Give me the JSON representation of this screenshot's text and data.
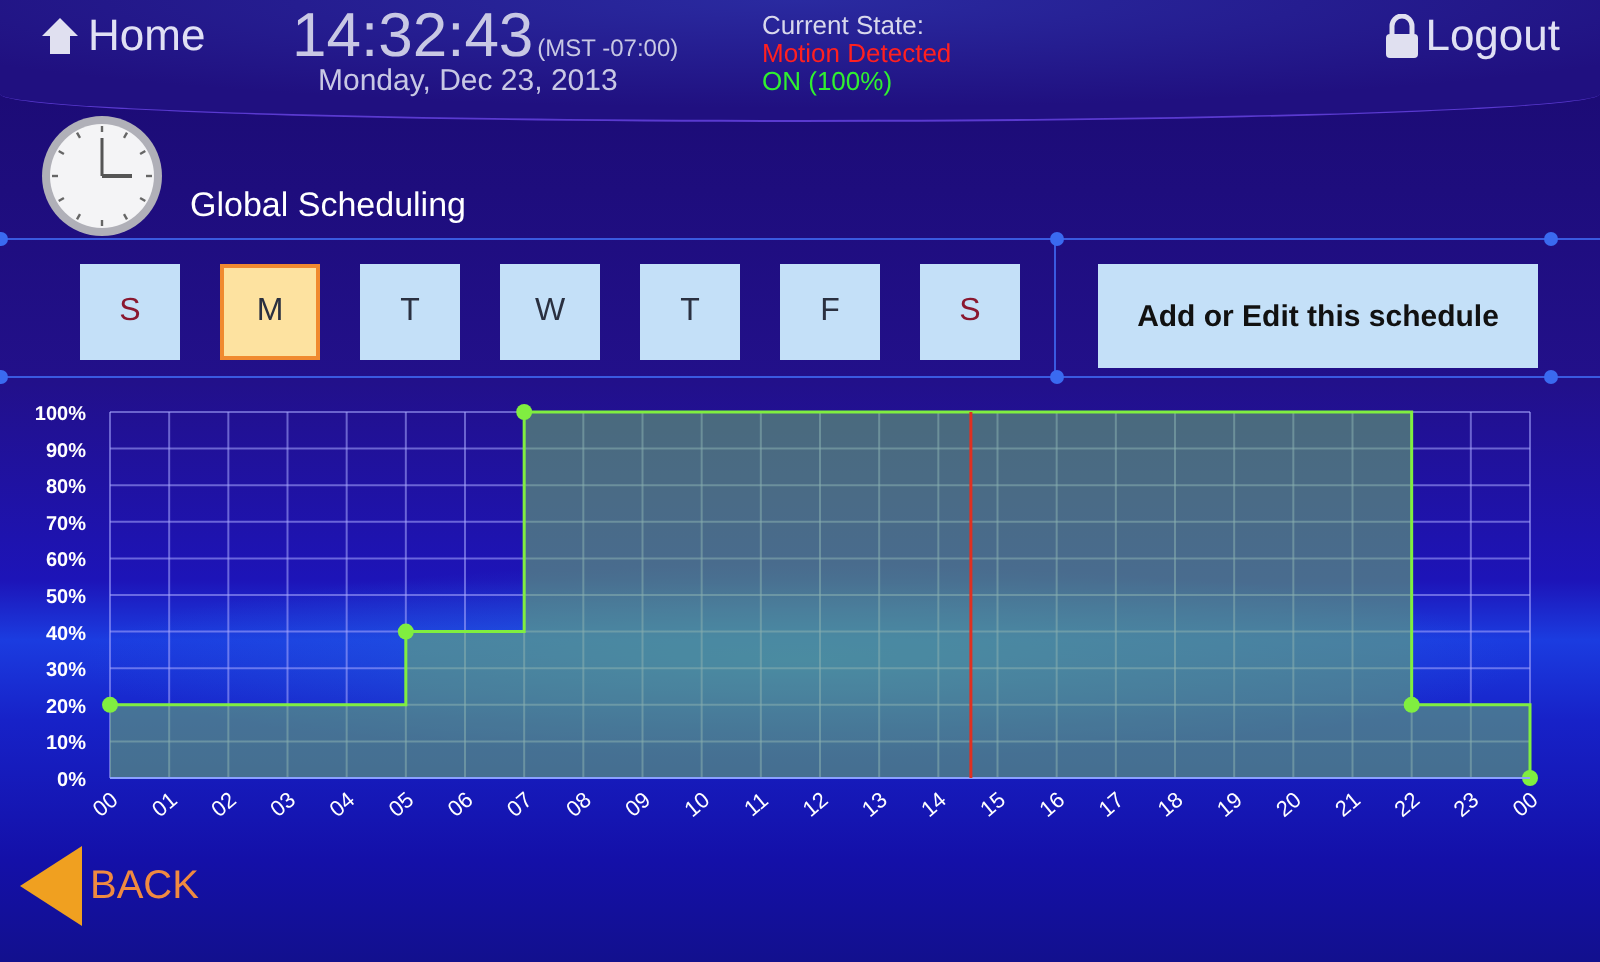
{
  "header": {
    "home": "Home",
    "time": "14:32:43",
    "timezone": "(MST -07:00)",
    "date": "Monday, Dec 23, 2013",
    "state_label": "Current State:",
    "state_motion": "Motion Detected",
    "state_level": "ON (100%)",
    "logout": "Logout"
  },
  "page_title": "Global Scheduling",
  "days": [
    {
      "label": "S",
      "weekend": true,
      "selected": false
    },
    {
      "label": "M",
      "weekend": false,
      "selected": true
    },
    {
      "label": "T",
      "weekend": false,
      "selected": false
    },
    {
      "label": "W",
      "weekend": false,
      "selected": false
    },
    {
      "label": "T",
      "weekend": false,
      "selected": false
    },
    {
      "label": "F",
      "weekend": false,
      "selected": false
    },
    {
      "label": "S",
      "weekend": true,
      "selected": false
    }
  ],
  "edit_button": "Add or Edit this schedule",
  "chart_data": {
    "type": "area",
    "x": [
      0,
      5,
      7,
      22,
      24
    ],
    "series": [
      {
        "color": "#80ee40",
        "values": [
          20,
          40,
          100,
          20,
          0
        ]
      }
    ],
    "grid": true,
    "xlim": [
      0,
      24
    ],
    "ylim": [
      0,
      100
    ],
    "xticks": [
      {
        "value": 0,
        "label": "00"
      },
      {
        "value": 1,
        "label": "01"
      },
      {
        "value": 2,
        "label": "02"
      },
      {
        "value": 3,
        "label": "03"
      },
      {
        "value": 4,
        "label": "04"
      },
      {
        "value": 5,
        "label": "05"
      },
      {
        "value": 6,
        "label": "06"
      },
      {
        "value": 7,
        "label": "07"
      },
      {
        "value": 8,
        "label": "08"
      },
      {
        "value": 9,
        "label": "09"
      },
      {
        "value": 10,
        "label": "10"
      },
      {
        "value": 11,
        "label": "11"
      },
      {
        "value": 12,
        "label": "12"
      },
      {
        "value": 13,
        "label": "13"
      },
      {
        "value": 14,
        "label": "14"
      },
      {
        "value": 15,
        "label": "15"
      },
      {
        "value": 16,
        "label": "16"
      },
      {
        "value": 17,
        "label": "17"
      },
      {
        "value": 18,
        "label": "18"
      },
      {
        "value": 19,
        "label": "19"
      },
      {
        "value": 20,
        "label": "20"
      },
      {
        "value": 21,
        "label": "21"
      },
      {
        "value": 22,
        "label": "22"
      },
      {
        "value": 23,
        "label": "23"
      },
      {
        "value": 24,
        "label": "00"
      }
    ],
    "yticks": [
      {
        "value": 0,
        "label": "0%"
      },
      {
        "value": 10,
        "label": "10%"
      },
      {
        "value": 20,
        "label": "20%"
      },
      {
        "value": 30,
        "label": "30%"
      },
      {
        "value": 40,
        "label": "40%"
      },
      {
        "value": 50,
        "label": "50%"
      },
      {
        "value": 60,
        "label": "60%"
      },
      {
        "value": 70,
        "label": "70%"
      },
      {
        "value": 80,
        "label": "80%"
      },
      {
        "value": 90,
        "label": "90%"
      },
      {
        "value": 100,
        "label": "100%"
      }
    ],
    "ref_lines": [
      {
        "axis": "x",
        "value": 14.55,
        "color": "#e03020"
      }
    ]
  },
  "back": "BACK"
}
